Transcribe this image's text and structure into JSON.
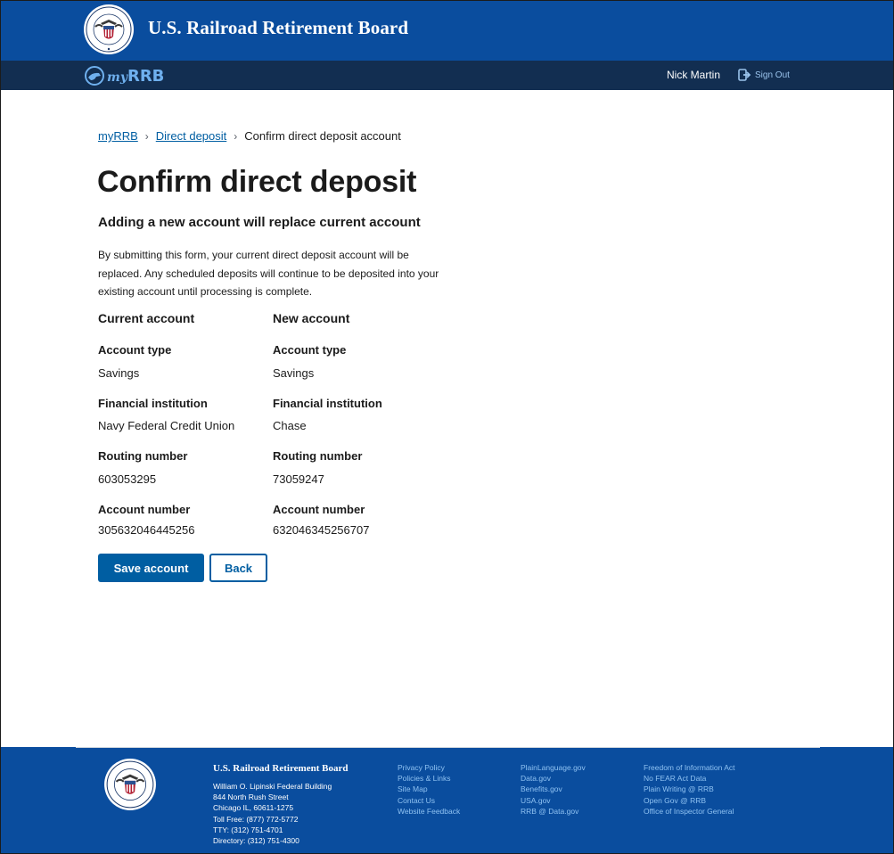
{
  "header": {
    "site_title": "U.S. Railroad Retirement Board",
    "app_logo_prefix": "my",
    "app_logo_text": "RRB",
    "user_name": "Nick Martin",
    "sign_out_label": "Sign Out"
  },
  "breadcrumb": [
    {
      "label": "myRRB"
    },
    {
      "label": "Direct deposit"
    },
    {
      "label": "Confirm direct deposit account"
    }
  ],
  "main": {
    "title": "Confirm direct deposit",
    "subheading": "Adding a new account will replace current account",
    "intro": "By submitting this form, your current direct deposit account will be replaced. Any scheduled deposits will continue to be deposited into your existing account until processing is complete.",
    "current": {
      "heading": "Current account",
      "account_type_label": "Account type",
      "account_type": "Savings",
      "institution_label": "Financial institution",
      "institution": "Navy Federal Credit Union",
      "routing_label": "Routing number",
      "routing": "603053295",
      "account_number_label": "Account number",
      "account_number": "305632046445256"
    },
    "new": {
      "heading": "New account",
      "account_type_label": "Account type",
      "account_type": "Savings",
      "institution_label": "Financial institution",
      "institution": "Chase",
      "routing_label": "Routing number",
      "routing": "73059247",
      "account_number_label": "Account number",
      "account_number": "632046345256707"
    },
    "save_label": "Save account",
    "back_label": "Back"
  },
  "footer": {
    "title": "U.S. Railroad Retirement Board",
    "address": [
      "William O. Lipinski Federal Building",
      "844 North Rush Street",
      "Chicago IL, 60611-1275",
      "Toll Free: (877) 772-5772",
      "TTY: (312) 751-4701",
      "Directory: (312) 751-4300"
    ],
    "links_col1": [
      "Privacy Policy",
      "Policies & Links",
      "Site Map",
      "Contact Us",
      "Website Feedback"
    ],
    "links_col2": [
      "PlainLanguage.gov",
      "Data.gov",
      "Benefits.gov",
      "USA.gov",
      "RRB @ Data.gov"
    ],
    "links_col3": [
      "Freedom of Information Act",
      "No FEAR Act Data",
      "Plain Writing @ RRB",
      "Open Gov @ RRB",
      "Office of Inspector General"
    ]
  },
  "colors": {
    "header_blue": "#0a4d9e",
    "nav_dark": "#122e51",
    "link_blue": "#005ea2"
  },
  "icons": {
    "seal": "rrb-seal-icon",
    "app_logo": "myrrb-logo-icon",
    "sign_out": "sign-out-icon",
    "breadcrumb_separator": "chevron-right-icon"
  }
}
